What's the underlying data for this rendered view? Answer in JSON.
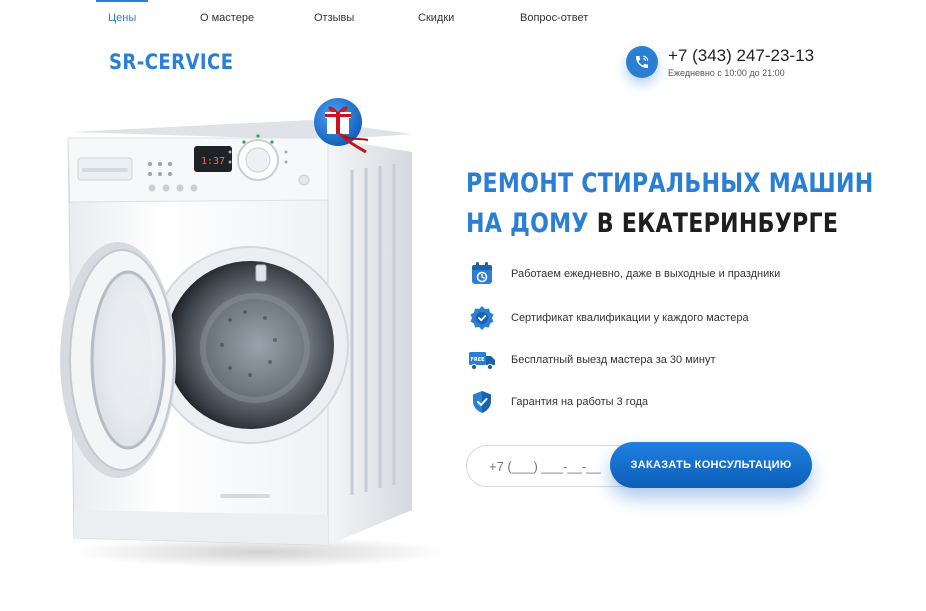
{
  "nav": {
    "items": [
      {
        "label": "Цены",
        "active": true
      },
      {
        "label": "О мастере"
      },
      {
        "label": "Отзывы"
      },
      {
        "label": "Скидки"
      },
      {
        "label": "Вопрос-ответ"
      }
    ]
  },
  "header": {
    "logo": "SR-CERVICE",
    "phone": "+7 (343) 247-23-13",
    "hours": "Ежедневно с 10:00 до 21:00"
  },
  "washer": {
    "display": "1:37"
  },
  "hero": {
    "title_line1": "РЕМОНТ СТИРАЛЬНЫХ МАШИН",
    "title_line2_accent": "НА ДОМУ",
    "title_line2_rest": "В ЕКАТЕРИНБУРГЕ"
  },
  "features": [
    {
      "icon": "calendar-icon",
      "text": "Работаем ежедневно, даже в выходные и праздники"
    },
    {
      "icon": "certificate-badge-icon",
      "text": "Сертификат квалификации у каждого мастера"
    },
    {
      "icon": "free-delivery-truck-icon",
      "text": "Бесплатный выезд мастера за 30 минут",
      "badge": "FREE"
    },
    {
      "icon": "shield-check-icon",
      "text": "Гарантия на работы 3 года"
    }
  ],
  "form": {
    "phone_placeholder": "+7 (___) ___-__-__",
    "submit_label": "ЗАКАЗАТЬ КОНСУЛЬТАЦИЮ"
  },
  "colors": {
    "accent": "#2a7fd4",
    "button_gradient_top": "#1f7fe0",
    "button_gradient_bottom": "#0d5fb8",
    "gift_ribbon": "#c8141e"
  }
}
